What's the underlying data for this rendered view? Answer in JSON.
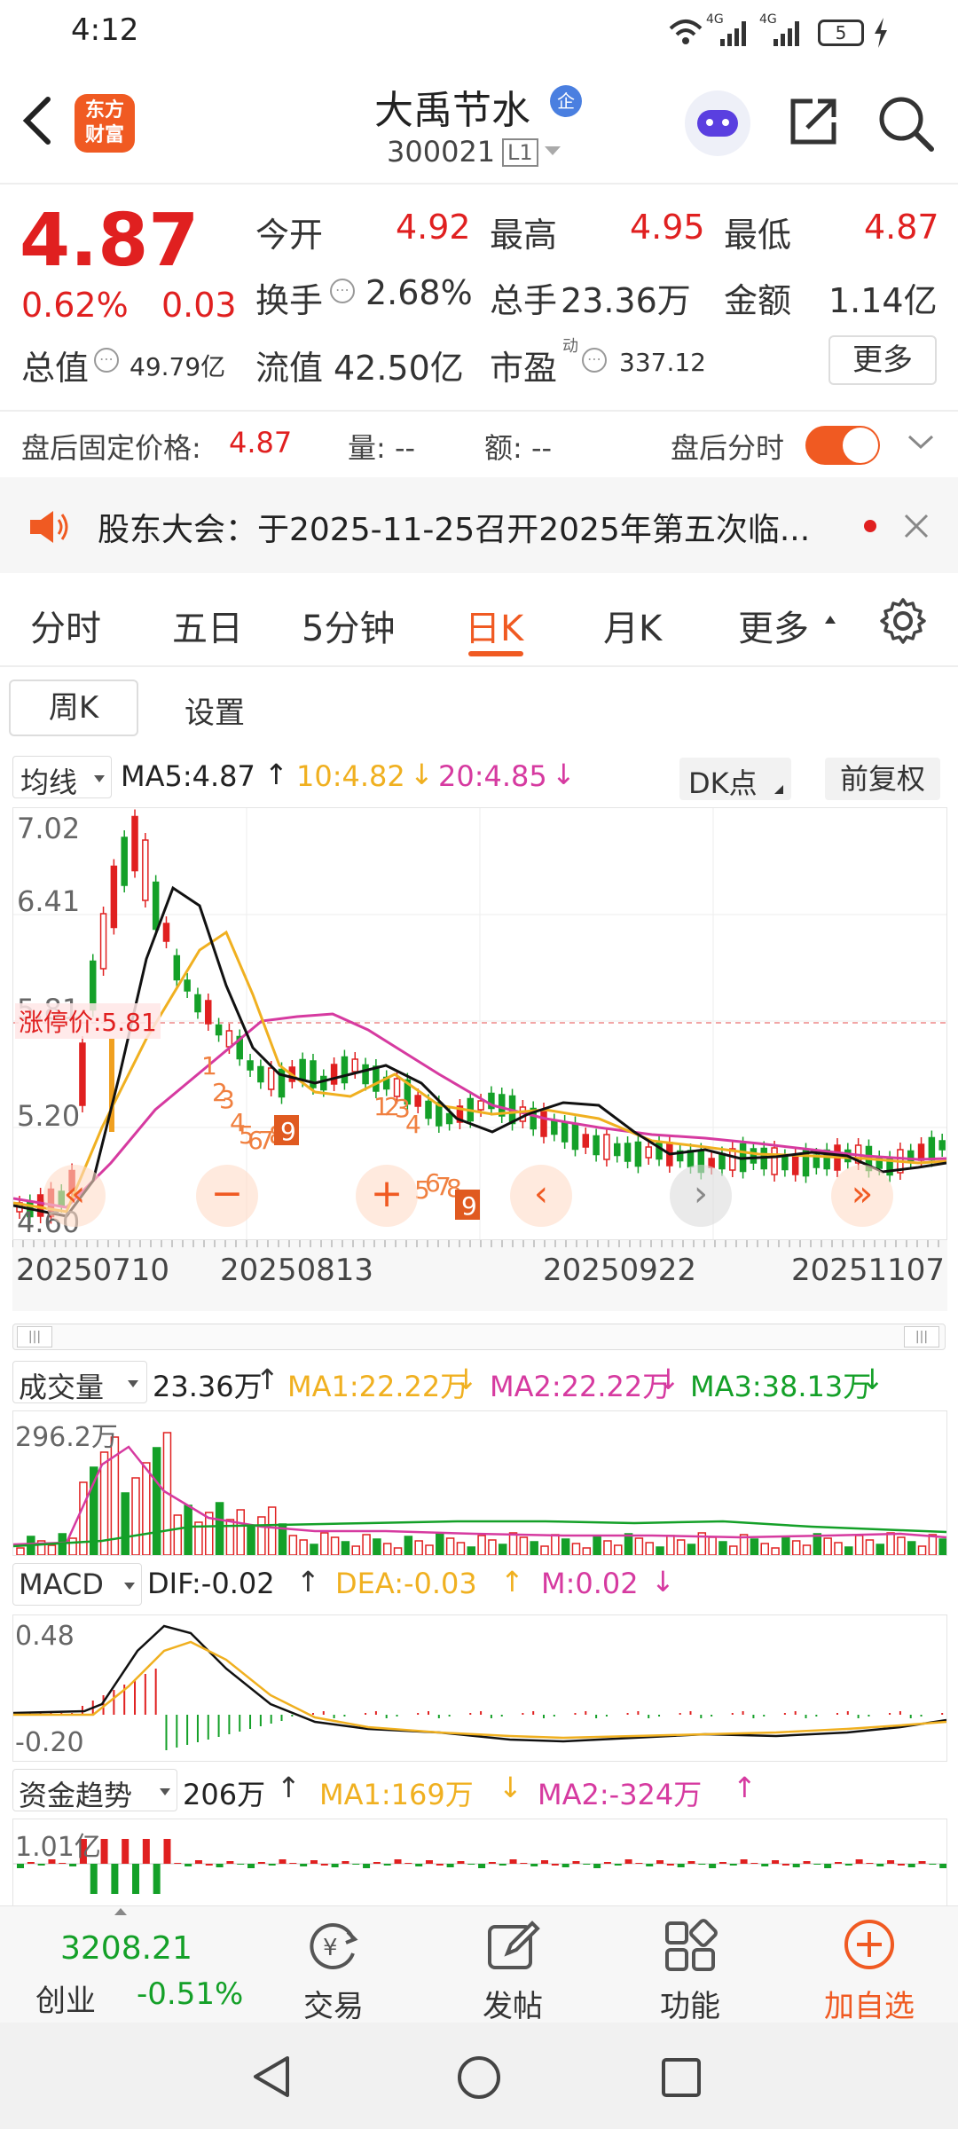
{
  "status": {
    "time": "4:12",
    "signal1": "4G",
    "signal2": "4G",
    "battery": "5"
  },
  "header": {
    "stock_name": "大禹节水",
    "badge": "企",
    "stock_code": "300021",
    "level": "L1",
    "logo_line1": "东方",
    "logo_line2": "财富"
  },
  "quote": {
    "price": "4.87",
    "change_pct": "0.62%",
    "change": "0.03",
    "open_label": "今开",
    "open": "4.92",
    "high_label": "最高",
    "high": "4.95",
    "low_label": "最低",
    "low": "4.87",
    "turnover_label": "换手",
    "turnover": "2.68%",
    "volume_label": "总手",
    "volume": "23.36万",
    "amount_label": "金额",
    "amount": "1.14亿",
    "mktcap_label": "总值",
    "mktcap": "49.79亿",
    "float_label": "流值",
    "float": "42.50亿",
    "pe_label": "市盈",
    "pe_sup": "动",
    "pe": "337.12",
    "more_button": "更多"
  },
  "afterhours": {
    "fixed_label": "盘后固定价格:",
    "fixed_price": "4.87",
    "qty_label": "量: --",
    "amt_label": "额: --",
    "timeline_label": "盘后分时"
  },
  "notice": {
    "text": "股东大会：于2025-11-25召开2025年第五次临..."
  },
  "tabs": [
    "分时",
    "五日",
    "5分钟",
    "日K",
    "月K",
    "更多"
  ],
  "subtabs": {
    "weekly": "周K",
    "settings": "设置"
  },
  "kline": {
    "ma_selector": "均线",
    "ma5": "MA5:4.87",
    "ma10": "10:4.82",
    "ma20": "20:4.85",
    "dk_button": "DK点",
    "adjust_button": "前复权",
    "y_ticks": [
      "7.02",
      "6.41",
      "5.81",
      "5.20",
      "4.60"
    ],
    "limit_label": "涨停价:5.81",
    "dates": [
      "20250710",
      "20250813",
      "20250922",
      "20251107"
    ]
  },
  "volume": {
    "selector": "成交量",
    "value": "23.36万",
    "ma1": "MA1:22.22万",
    "ma2": "MA2:22.22万",
    "ma3": "MA3:38.13万",
    "ymax": "296.2万"
  },
  "macd": {
    "selector": "MACD",
    "dif": "DIF:-0.02",
    "dea": "DEA:-0.03",
    "m": "M:0.02",
    "ymax": "0.48",
    "ymin": "-0.20"
  },
  "funds": {
    "selector": "资金趋势",
    "value": "206万",
    "ma1": "MA1:169万",
    "ma2": "MA2:-324万",
    "ymax": "1.01亿"
  },
  "bottom_nav": {
    "index_value": "3208.21",
    "index_name": "创业",
    "index_change": "-0.51%",
    "trade": "交易",
    "post": "发帖",
    "functions": "功能",
    "add_watch": "加自选"
  },
  "chart_data": {
    "type": "candlestick",
    "y_range": [
      4.6,
      7.02
    ],
    "limit_price": 5.81,
    "x_labels": [
      "20250710",
      "20250813",
      "20250922",
      "20251107"
    ],
    "colors": {
      "up": "#e02020",
      "down": "#14a028",
      "ma5": "#111111",
      "ma10": "#f0b020",
      "ma20": "#d63aa0"
    }
  }
}
